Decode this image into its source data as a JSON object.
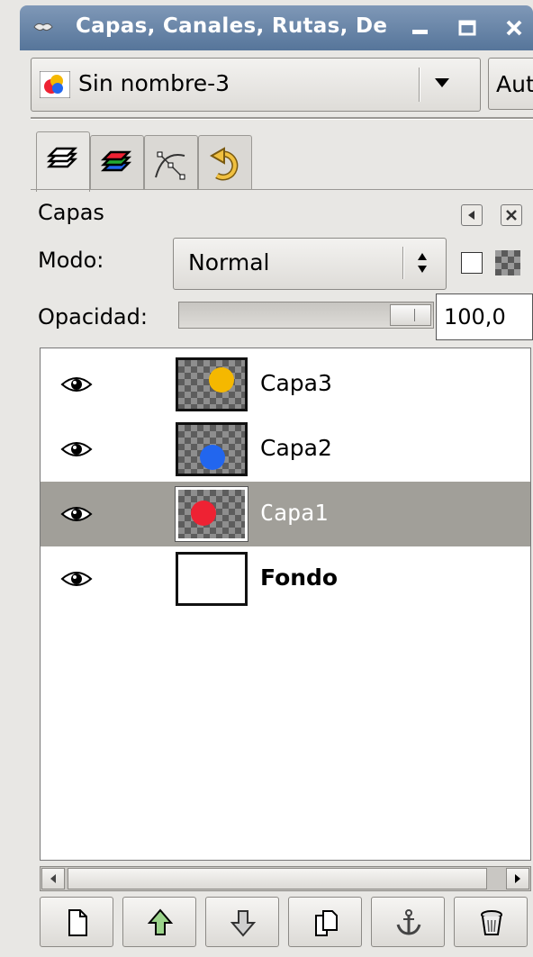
{
  "window": {
    "title": "Capas, Canales, Rutas, De"
  },
  "image_selector": {
    "image_name": "Sin nombre-3",
    "auto_label": "Auto"
  },
  "tabs": [
    {
      "icon": "layers-icon"
    },
    {
      "icon": "channels-icon"
    },
    {
      "icon": "paths-icon"
    },
    {
      "icon": "undo-history-icon"
    }
  ],
  "layers_panel": {
    "title": "Capas",
    "mode_label": "Modo:",
    "mode_value": "Normal",
    "opacity_label": "Opacidad:",
    "opacity_value": "100,0",
    "opacity_fraction": 1.0
  },
  "layers": [
    {
      "name": "Capa3",
      "dot_color": "#f5b800",
      "selected": false
    },
    {
      "name": "Capa2",
      "dot_color": "#2266ee",
      "selected": false
    },
    {
      "name": "Capa1",
      "dot_color": "#ee2233",
      "selected": true
    },
    {
      "name": "Fondo",
      "dot_color": null,
      "selected": false
    }
  ],
  "bottom_buttons": [
    {
      "icon": "new-layer-icon"
    },
    {
      "icon": "raise-layer-icon"
    },
    {
      "icon": "lower-layer-icon"
    },
    {
      "icon": "duplicate-layer-icon"
    },
    {
      "icon": "anchor-layer-icon"
    },
    {
      "icon": "delete-layer-icon"
    }
  ],
  "colors": {
    "titlebar": "#56759a",
    "selection": "#a19f99"
  }
}
